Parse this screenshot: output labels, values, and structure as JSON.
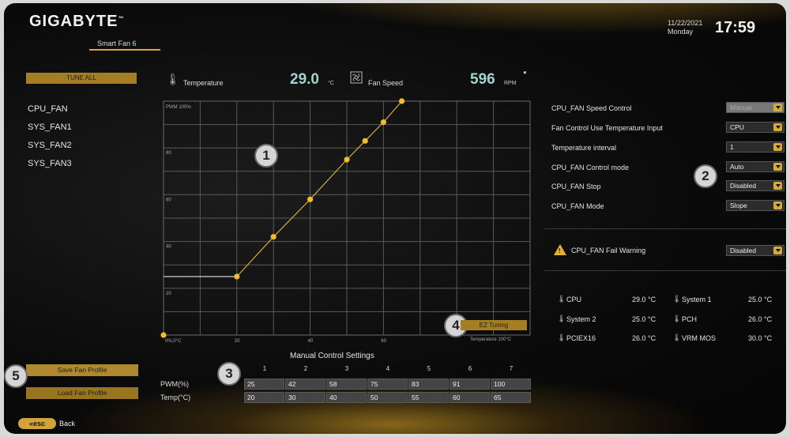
{
  "header": {
    "logo": "GIGABYTE",
    "logo_tm": "™",
    "subtitle": "Smart Fan 6",
    "date": "11/22/2021",
    "weekday": "Monday",
    "time": "17:59"
  },
  "sidebar": {
    "tune_all": "TUNE ALL",
    "fans": [
      "CPU_FAN",
      "SYS_FAN1",
      "SYS_FAN2",
      "SYS_FAN3"
    ],
    "save_profile": "Save Fan Profile",
    "load_profile": "Load Fan Profile"
  },
  "footer": {
    "esc": "«esc",
    "back": "Back"
  },
  "readouts": {
    "temperature_label": "Temperature",
    "temperature_value": "29.0",
    "temperature_unit": "°C",
    "fan_speed_label": "Fan Speed",
    "fan_speed_value": "596",
    "fan_speed_unit": "RPM"
  },
  "badges": [
    "1",
    "2",
    "3",
    "4",
    "5"
  ],
  "chart_data": {
    "type": "line",
    "y_axis_title": "PWM 100%",
    "y_ticks": [
      "80",
      "60",
      "40",
      "20"
    ],
    "x_origin_label": "0%,0°C",
    "x_ticks": [
      "20",
      "40",
      "60"
    ],
    "x_axis_title": "Temperature 100°C",
    "xlim": [
      0,
      100
    ],
    "ylim": [
      0,
      100
    ],
    "grid": true,
    "line_color": "#d6a93a",
    "flat_segment": {
      "y": 25,
      "x": [
        0,
        20
      ]
    },
    "points": [
      {
        "x": 0,
        "y": 0
      },
      {
        "x": 20,
        "y": 25
      },
      {
        "x": 30,
        "y": 42
      },
      {
        "x": 40,
        "y": 58
      },
      {
        "x": 50,
        "y": 75
      },
      {
        "x": 55,
        "y": 83
      },
      {
        "x": 60,
        "y": 91
      },
      {
        "x": 65,
        "y": 100
      }
    ]
  },
  "ez_tuning": "EZ Tuning",
  "manual": {
    "title": "Manual Control Settings",
    "columns": [
      "1",
      "2",
      "3",
      "4",
      "5",
      "6",
      "7"
    ],
    "pwm_label": "PWM(%)",
    "temp_label": "Temp(°C)",
    "pwm": [
      "25",
      "42",
      "58",
      "75",
      "83",
      "91",
      "100"
    ],
    "temp": [
      "20",
      "30",
      "40",
      "50",
      "55",
      "60",
      "65"
    ]
  },
  "settings": [
    {
      "label": "CPU_FAN Speed Control",
      "value": "Manual",
      "disabled": true
    },
    {
      "label": "Fan Control Use Temperature Input",
      "value": "CPU",
      "disabled": false
    },
    {
      "label": "Temperature interval",
      "value": "1",
      "disabled": false
    },
    {
      "label": "CPU_FAN Control mode",
      "value": "Auto",
      "disabled": false
    },
    {
      "label": "CPU_FAN Stop",
      "value": "Disabled",
      "disabled": false
    },
    {
      "label": "CPU_FAN Mode",
      "value": "Slope",
      "disabled": false
    }
  ],
  "fail_warning": {
    "label": "CPU_FAN Fail Warning",
    "value": "Disabled"
  },
  "sensors": [
    {
      "name": "CPU",
      "value": "29.0 °C"
    },
    {
      "name": "System 1",
      "value": "25.0 °C"
    },
    {
      "name": "System 2",
      "value": "25.0 °C"
    },
    {
      "name": "PCH",
      "value": "26.0 °C"
    },
    {
      "name": "PCIEX16",
      "value": "26.0 °C"
    },
    {
      "name": "VRM MOS",
      "value": "30.0 °C"
    }
  ]
}
